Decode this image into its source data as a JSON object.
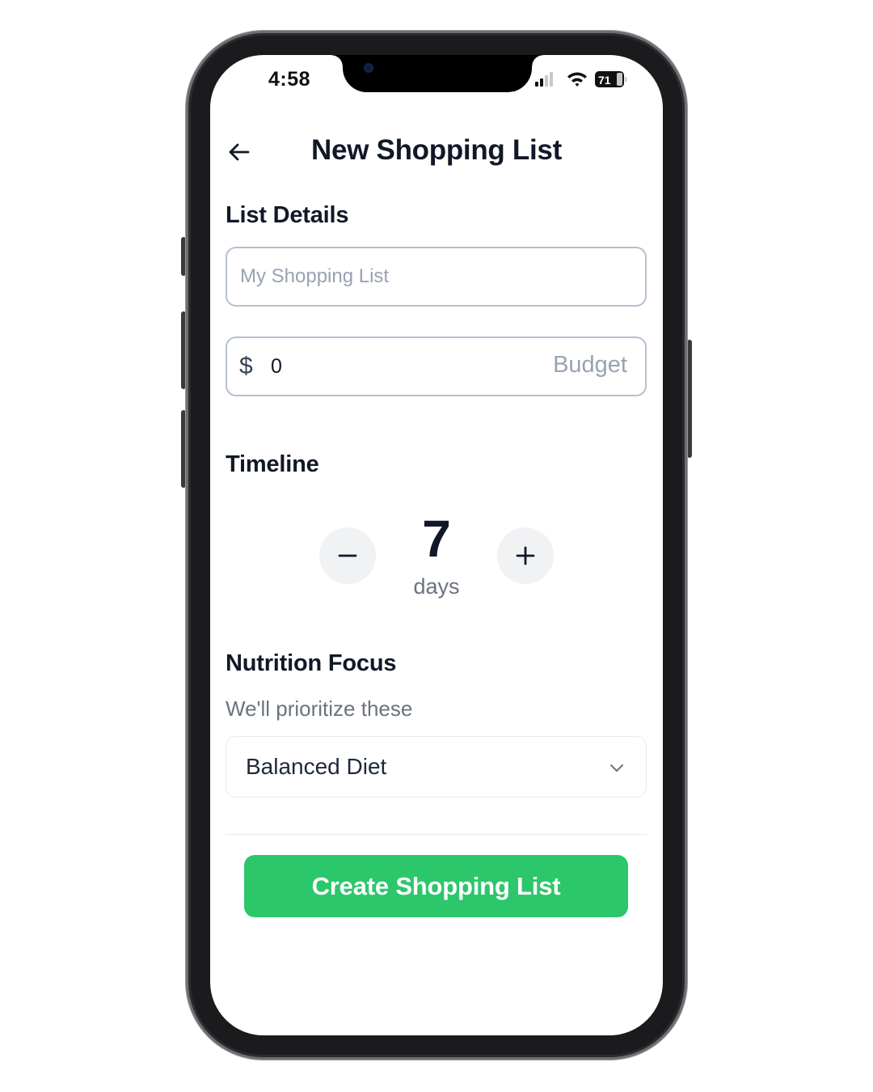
{
  "status_bar": {
    "time": "4:58",
    "battery_level": "71",
    "icons": [
      "cellular-signal-icon",
      "wifi-icon",
      "battery-icon"
    ]
  },
  "header": {
    "back_icon": "arrow-left-icon",
    "title": "New Shopping List"
  },
  "list_details": {
    "heading": "List Details",
    "name_placeholder": "My Shopping List",
    "name_value": "",
    "currency_symbol": "$",
    "budget_value": "0",
    "budget_label": "Budget"
  },
  "timeline": {
    "heading": "Timeline",
    "days": "7",
    "unit": "days",
    "decrement_icon": "minus-icon",
    "increment_icon": "plus-icon"
  },
  "nutrition": {
    "heading": "Nutrition Focus",
    "subtitle": "We'll prioritize these",
    "selected": "Balanced Diet",
    "dropdown_icon": "chevron-down-icon"
  },
  "actions": {
    "create_label": "Create Shopping List"
  },
  "colors": {
    "primary": "#2cc76b",
    "text_dark": "#111827",
    "text_muted": "#6b7280",
    "placeholder": "#98a2b3",
    "input_border": "#b6c0d0",
    "stepper_bg": "#f1f2f4"
  }
}
